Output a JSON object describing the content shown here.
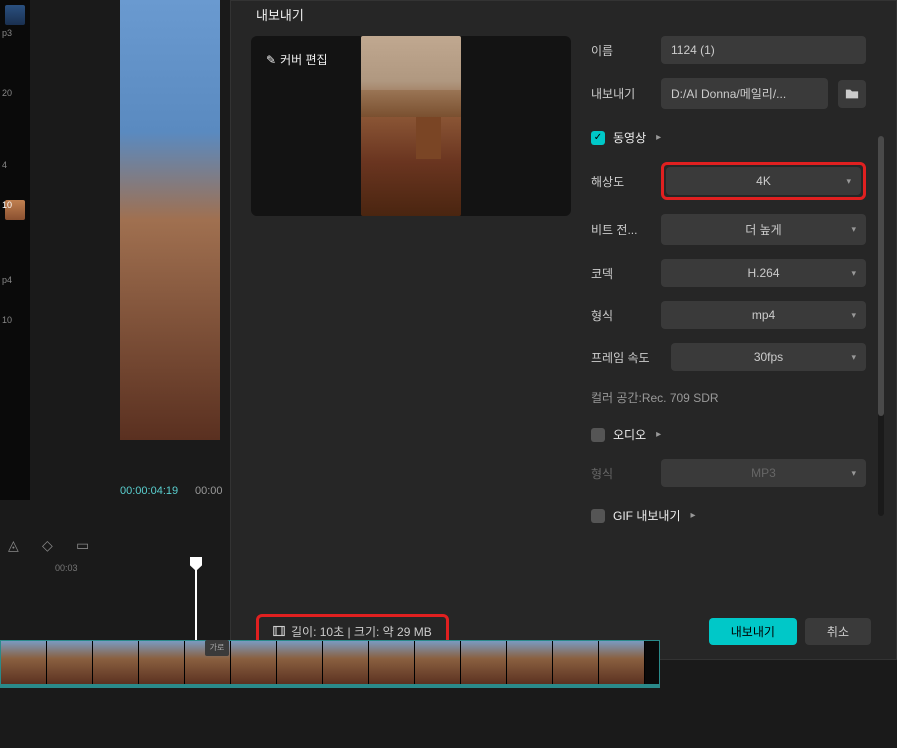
{
  "dialog": {
    "title": "내보내기",
    "cover_edit": "커버 편집",
    "name_label": "이름",
    "name_value": "1124 (1)",
    "export_label": "내보내기",
    "export_path": "D:/AI Donna/메일리/...",
    "sections": {
      "video": "동영상",
      "audio": "오디오",
      "gif": "GIF 내보내기"
    },
    "fields": {
      "resolution_label": "해상도",
      "resolution_value": "4K",
      "bitrate_label": "비트 전...",
      "bitrate_value": "더 높게",
      "codec_label": "코덱",
      "codec_value": "H.264",
      "format_label": "형식",
      "format_value": "mp4",
      "framerate_label": "프레임 속도",
      "framerate_value": "30fps",
      "audio_format_label": "형식",
      "audio_format_value": "MP3"
    },
    "color_space": "컬러 공간:Rec. 709 SDR",
    "file_info": "길이: 10초 | 크기: 약 29 MB",
    "export_btn": "내보내기",
    "cancel_btn": "취소"
  },
  "timeline": {
    "timecode1": "00:00:04:19",
    "timecode2": "00:00",
    "ruler_mark": "00:03",
    "track_label": "가로"
  },
  "sidebar": {
    "label_20": "20",
    "label_4": "4",
    "label_10": "10",
    "label_p4": "p4",
    "label_10b": "10",
    "label_p3": "p3"
  }
}
